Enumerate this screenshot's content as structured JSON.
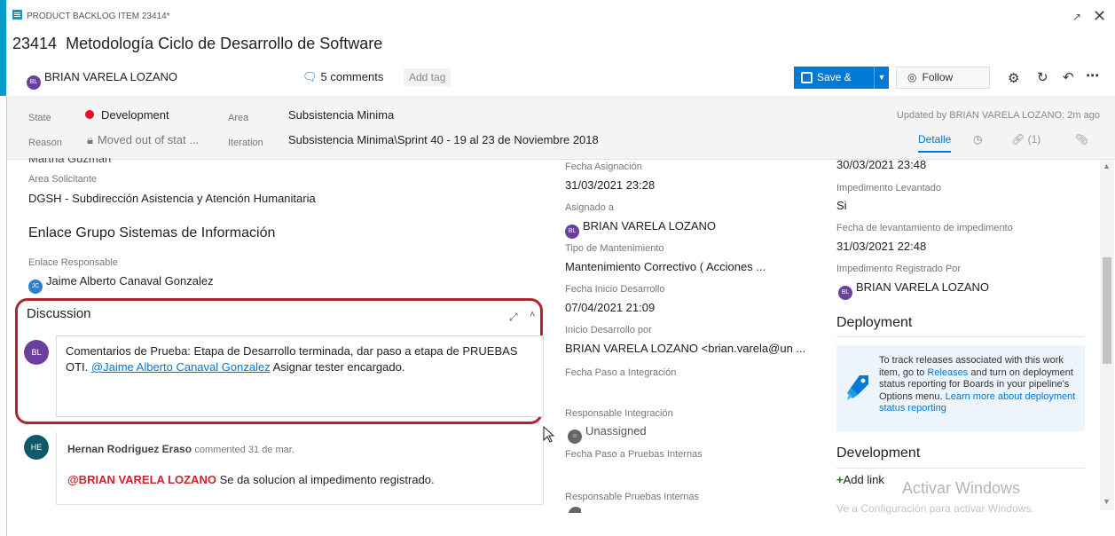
{
  "window": {
    "type_label": "PRODUCT BACKLOG ITEM 23414*",
    "id": "23414",
    "title": "Metodología Ciclo de Desarrollo de Software",
    "accent_color": "#009ccc"
  },
  "header": {
    "assigned_initials": "BL",
    "assigned_name": "BRIAN VARELA LOZANO",
    "comments_label": "5 comments",
    "add_tag_label": "Add tag",
    "save_label": "Save & Close",
    "follow_label": "Follow"
  },
  "info_bar": {
    "state_label": "State",
    "state_value": "Development",
    "state_color": "#e81123",
    "reason_label": "Reason",
    "reason_value": "Moved out of stat ...",
    "area_label": "Area",
    "area_value": "Subsistencia Minima",
    "iteration_label": "Iteration",
    "iteration_value": "Subsistencia Minima\\Sprint 40 - 19 al 23 de Noviembre 2018",
    "updated_text": "Updated by BRIAN VARELA LOZANO: 2m ago",
    "tabs": {
      "detail": "Detalle",
      "links_count": "(1)"
    }
  },
  "left": {
    "cut_off_value": "Martha Guzmán",
    "area_solicitante_label": "Area Solicitante",
    "area_solicitante_value": "DGSH - Subdirección Asistencia y Atención Humanitaria",
    "enlace_section_title": "Enlace Grupo Sistemas de Información",
    "enlace_responsable_label": "Enlace Responsable",
    "enlace_responsable_initials": "JC",
    "enlace_responsable_value": "Jaime Alberto Canaval Gonzalez",
    "discussion_title": "Discussion",
    "editor": {
      "initials": "BL",
      "text_part1": "Comentarios de Prueba: Etapa de Desarrollo terminada, dar paso a etapa de PRUEBAS OTI. ",
      "mention": "@Jaime Alberto Canaval Gonzalez",
      "text_part2": " Asignar tester encargado."
    },
    "comment": {
      "initials": "HE",
      "author": "Hernan Rodriguez Eraso",
      "meta": "commented 31 de mar.",
      "mention": "@BRIAN VARELA LOZANO",
      "text": " Se da solucion al impedimento registrado."
    }
  },
  "middle": {
    "fecha_asignacion_label": "Fecha Asignación",
    "fecha_asignacion_value": "31/03/2021 23:28",
    "asignado_label": "Asignado a",
    "asignado_initials": "BL",
    "asignado_value": "BRIAN VARELA LOZANO",
    "tipo_mant_label": "Tipo de Mantenimiento",
    "tipo_mant_value": "Mantenimiento Correctivo ( Acciones ...",
    "fecha_inicio_label": "Fecha Inicio Desarrollo",
    "fecha_inicio_value": "07/04/2021 21:09",
    "inicio_por_label": "Inicio Desarrollo por",
    "inicio_por_value": "BRIAN VARELA LOZANO <brian.varela@un ...",
    "fecha_integracion_label": "Fecha Paso a Integración",
    "resp_integracion_label": "Responsable Integración",
    "resp_integracion_value": "Unassigned",
    "fecha_pruebas_label": "Fecha Paso a Pruebas Internas",
    "resp_pruebas_label": "Responsable Pruebas Internas"
  },
  "right": {
    "top_date": "30/03/2021 23:48",
    "imp_levantado_label": "Impedimento Levantado",
    "imp_levantado_value": "Si",
    "fecha_lev_label": "Fecha de levantamiento de impedimento",
    "fecha_lev_value": "31/03/2021 22:48",
    "imp_registrado_label": "Impedimento Registrado Por",
    "imp_registrado_initials": "BL",
    "imp_registrado_value": "BRIAN VARELA LOZANO",
    "deployment_title": "Deployment",
    "deploy_t1": "To track releases associated with this work item, go to ",
    "deploy_link1": "Releases",
    "deploy_t2": " and turn on deployment status reporting for Boards in your pipeline's Options menu. ",
    "deploy_link2": "Learn more about deployment status reporting",
    "development_title": "Development",
    "add_link_label": "Add link"
  },
  "watermark": {
    "line1": "Activar Windows",
    "line2": "Ve a Configuración para activar Windows."
  }
}
